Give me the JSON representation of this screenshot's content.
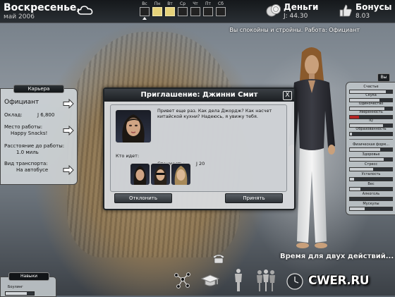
{
  "topbar": {
    "day": "Воскресенье,",
    "date": "май 2006",
    "weekdays": [
      {
        "label": "Вс",
        "filled": false,
        "current": true
      },
      {
        "label": "Пн",
        "filled": true,
        "current": false
      },
      {
        "label": "Вт",
        "filled": true,
        "current": false
      },
      {
        "label": "Ср",
        "filled": false,
        "current": false
      },
      {
        "label": "Чт",
        "filled": false,
        "current": false
      },
      {
        "label": "Пт",
        "filled": false,
        "current": false
      },
      {
        "label": "Сб",
        "filled": false,
        "current": false
      }
    ],
    "money_label": "Деньги",
    "money_value": "J: 44.30",
    "bonus_label": "Бонусы",
    "bonus_value": "8.03"
  },
  "status_line": "Вы спокойны и стройны. Работа: Официант",
  "career": {
    "title": "Карьера",
    "job": "Официант",
    "salary_label": "Оклад:",
    "salary_value": "J 6,800",
    "workplace_label": "Место работы:",
    "workplace_value": "Happy Snacks!",
    "distance_label": "Расстояние до работы:",
    "distance_value": "1.0 миль",
    "transport_label": "Вид транспорта:",
    "transport_value": "На автобусе"
  },
  "stats": {
    "tab_label": "Вы",
    "items": [
      {
        "name": "Счастье",
        "level": 0.85,
        "red": false
      },
      {
        "name": "Скука",
        "level": 0.7,
        "red": false
      },
      {
        "name": "Одиночество",
        "level": 0.82,
        "red": false
      },
      {
        "name": "Уверенность",
        "level": 0.22,
        "red": true
      },
      {
        "name": "IQ",
        "level": 0.78,
        "red": false
      },
      {
        "name": "Образованность",
        "level": 0.05,
        "red": false
      },
      {
        "name": "Физическая форм...",
        "level": 0.72,
        "red": false
      },
      {
        "name": "Здоровье",
        "level": 0.8,
        "red": false
      },
      {
        "name": "Стресс",
        "level": 0.55,
        "red": false
      },
      {
        "name": "Усталость",
        "level": 0.1,
        "red": false
      },
      {
        "name": "Вес",
        "level": 0.25,
        "red": false
      },
      {
        "name": "Алкоголь",
        "level": 0.0,
        "red": false
      },
      {
        "name": "Мускулы",
        "level": 0.35,
        "red": false
      }
    ]
  },
  "dialog": {
    "title": "Приглашение: Джинни Смит",
    "close": "X",
    "message": "Привет еще раз. Как дела Джордж? Как насчет китайской кухни? Надеюсь, я увижу тебя.",
    "cost_label": "Стоимость:",
    "cost_value": "J 20",
    "who_label": "Кто идет:",
    "decline": "Отклонить",
    "accept": "Принять"
  },
  "actions_text": "Время для двух действий...",
  "skills": {
    "title": "Навыки",
    "skill": "Боулинг",
    "level": 0.75
  },
  "watermark": "CWER.RU"
}
